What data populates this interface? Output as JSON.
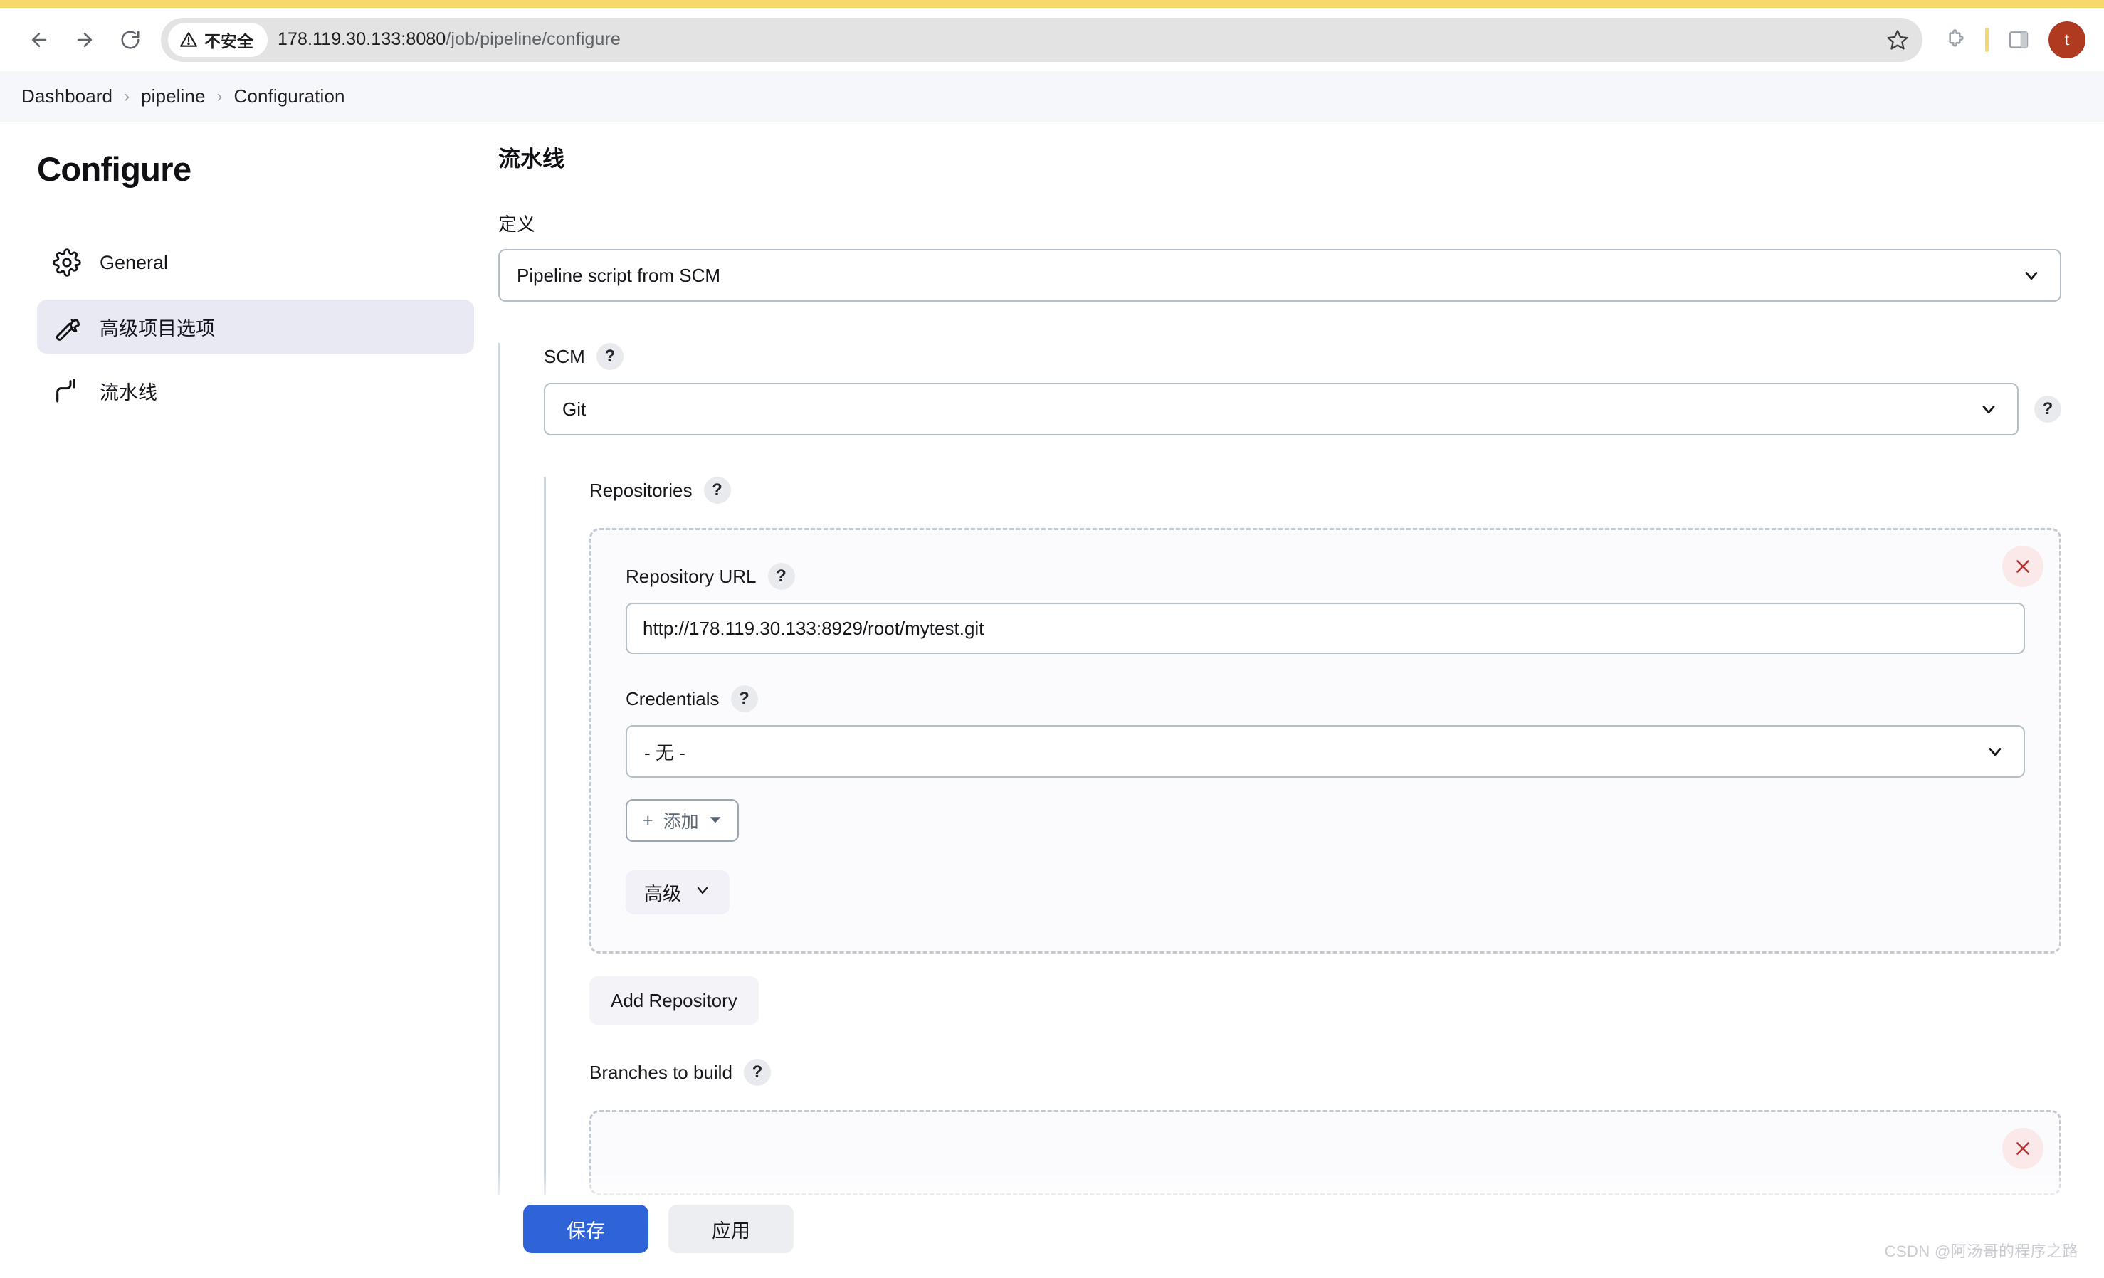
{
  "browser": {
    "back_icon": "back-arrow-icon",
    "forward_icon": "forward-arrow-icon",
    "reload_icon": "reload-icon",
    "security_label": "不安全",
    "url_host": "178.119.30.133:8080",
    "url_path": "/job/pipeline/configure",
    "url_full": "178.119.30.133:8080/job/pipeline/configure",
    "bookmark_icon": "star-icon",
    "extensions_icon": "puzzle-piece-icon",
    "sidepanel_icon": "split-panel-icon",
    "avatar_initial": "t",
    "avatar_color": "#b03a20",
    "accent_yellow": "#f6d96a"
  },
  "breadcrumb": {
    "items": [
      {
        "label": "Dashboard"
      },
      {
        "label": "pipeline"
      },
      {
        "label": "Configuration"
      }
    ],
    "separator": "›"
  },
  "sidebar": {
    "title": "Configure",
    "items": [
      {
        "label": "General",
        "icon": "gear-icon",
        "active": false
      },
      {
        "label": "高级项目选项",
        "icon": "wrench-icon",
        "active": true
      },
      {
        "label": "流水线",
        "icon": "pipeline-icon",
        "active": false
      }
    ]
  },
  "main": {
    "section_title": "流水线",
    "definition": {
      "label": "定义",
      "value": "Pipeline script from SCM"
    },
    "scm": {
      "label": "SCM",
      "help": "?",
      "value": "Git",
      "outer_help": "?"
    },
    "repositories": {
      "label": "Repositories",
      "help": "?",
      "repository_url": {
        "label": "Repository URL",
        "help": "?",
        "value": "http://178.119.30.133:8929/root/mytest.git"
      },
      "credentials": {
        "label": "Credentials",
        "help": "?",
        "value": "- 无 -",
        "add_button": "添加",
        "add_prefix": "+"
      },
      "advanced_button": "高级",
      "delete_icon": "close-icon",
      "add_repository_button": "Add Repository"
    },
    "branches": {
      "label": "Branches to build",
      "help": "?"
    }
  },
  "footer": {
    "save_label": "保存",
    "apply_label": "应用",
    "primary_color": "#2f63d8"
  },
  "watermark": "CSDN @阿汤哥的程序之路"
}
